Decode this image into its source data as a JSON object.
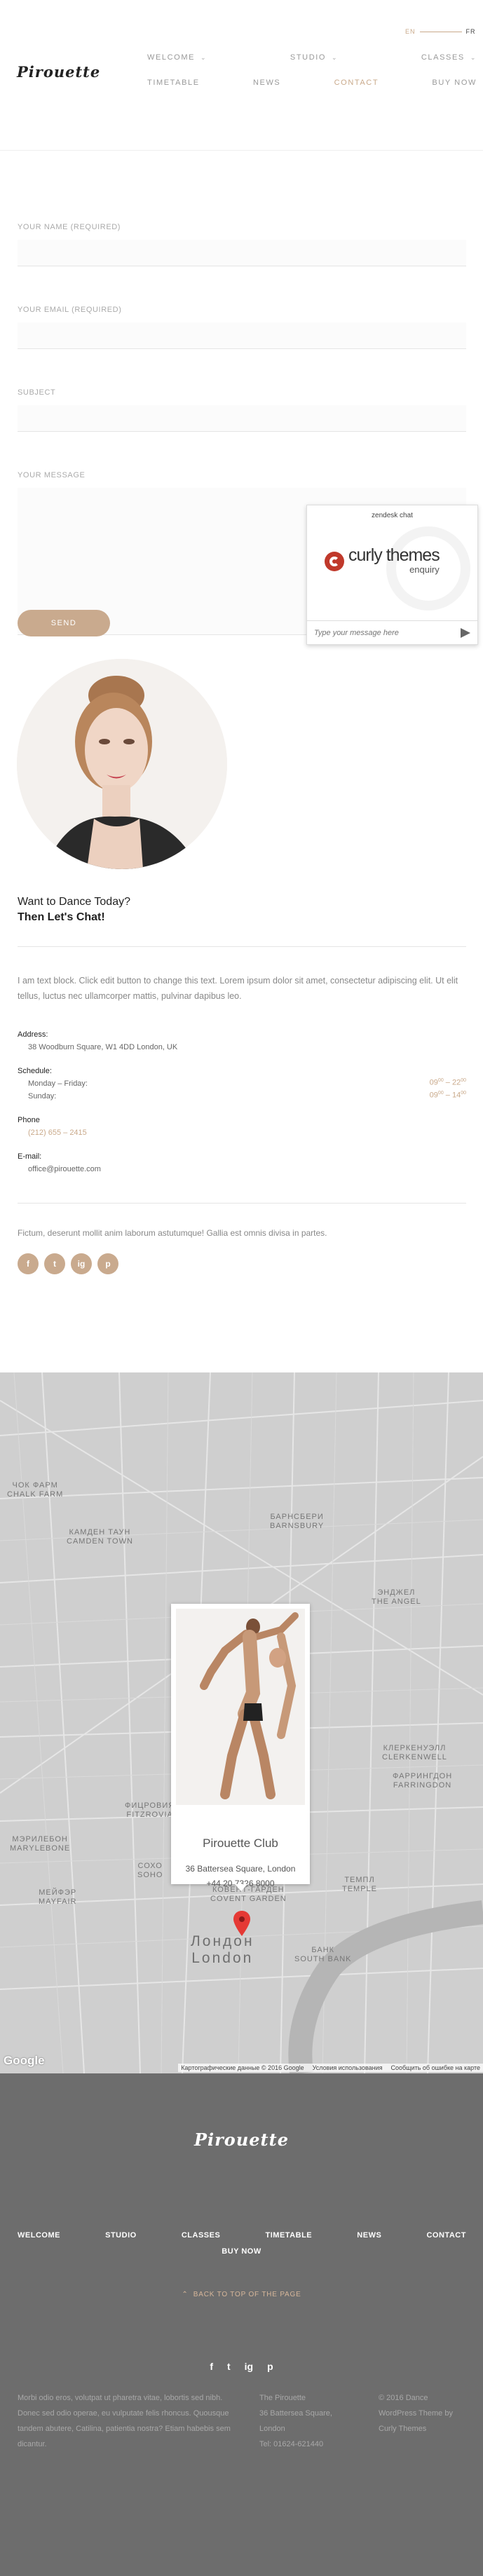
{
  "header": {
    "lang_active": "EN",
    "lang_other": "FR",
    "logo": "Pirouette",
    "nav_row1": [
      {
        "label": "WELCOME",
        "dropdown": true
      },
      {
        "label": "STUDIO",
        "dropdown": true
      },
      {
        "label": "CLASSES",
        "dropdown": true
      }
    ],
    "nav_row2": [
      {
        "label": "TIMETABLE",
        "active": false
      },
      {
        "label": "NEWS",
        "active": false
      },
      {
        "label": "CONTACT",
        "active": true
      },
      {
        "label": "BUY NOW",
        "active": false
      }
    ]
  },
  "form": {
    "name_label": "YOUR NAME (REQUIRED)",
    "email_label": "YOUR EMAIL (REQUIRED)",
    "subject_label": "SUBJECT",
    "message_label": "YOUR MESSAGE",
    "send_label": "SEND"
  },
  "chat": {
    "title": "zendesk chat",
    "brand": "curly themes",
    "sub": "enquiry",
    "placeholder": "Type your message here"
  },
  "contact": {
    "cta_line1": "Want to Dance Today?",
    "cta_line2": "Then Let's Chat!",
    "lorem": "I am text block. Click edit button to change this text. Lorem ipsum dolor sit amet, consectetur adipiscing elit. Ut elit tellus, luctus nec ullamcorper mattis, pulvinar dapibus leo.",
    "address_label": "Address:",
    "address": "38 Woodburn Square, W1 4DD London, UK",
    "schedule_label": "Schedule:",
    "weekdays": "Monday – Friday:",
    "weekdays_open": "09",
    "weekdays_open_min": "00",
    "weekdays_close": "22",
    "weekdays_close_min": "00",
    "sunday": "Sunday:",
    "sunday_open": "09",
    "sunday_open_min": "00",
    "sunday_close": "14",
    "sunday_close_min": "00",
    "phone_label": "Phone",
    "phone": "(212) 655 – 2415",
    "email_label": "E-mail:",
    "email": "office@pirouette.com",
    "tagline": "Fictum, deserunt mollit anim laborum astutumque! Gallia est omnis divisa in partes.",
    "socials": [
      "f",
      "t",
      "ig",
      "p"
    ]
  },
  "map": {
    "labels": [
      {
        "text": "ЧОК ФАРМ\nCHALK FARM"
      },
      {
        "text": "КАМДЕН ТАУН\nCAMDEN TOWN"
      },
      {
        "text": "БАРНСБЕРИ\nBARNSBURY"
      },
      {
        "text": "ЭНДЖЕЛ\nTHE ANGEL"
      },
      {
        "text": "КЛЕРКЕНУЭЛЛ\nCLERKENWELL"
      },
      {
        "text": "ФАРРИНГДОН\nFARRINGDON"
      },
      {
        "text": "ФИЦРОВИЯ\nFITZROVIA"
      },
      {
        "text": "МЭРИЛЕБОН\nMARYLEBONE"
      },
      {
        "text": "СОХО\nSOHO"
      },
      {
        "text": "КОВЕНТ-ГАРДЕН\nCOVENT GARDEN"
      },
      {
        "text": "МЕЙФЭР\nMAYFAIR"
      },
      {
        "text": "ТЕМПЛ\nTEMPLE"
      },
      {
        "text": "БАНК\nSOUTH BANK"
      }
    ],
    "city_ru": "Лондон",
    "city_en": "London",
    "club_name": "Pirouette Club",
    "club_address": "36 Battersea Square, London",
    "club_phone": "+44 20 7326 8000",
    "google": "Google",
    "terms": [
      "Картографические данные © 2016 Google",
      "Условия использования",
      "Сообщить об ошибке на карте"
    ]
  },
  "footer": {
    "logo": "Pirouette",
    "nav": [
      "WELCOME",
      "STUDIO",
      "CLASSES",
      "TIMETABLE",
      "NEWS",
      "CONTACT"
    ],
    "nav_extra": "BUY NOW",
    "back_to_top": "BACK TO TOP OF THE PAGE",
    "socials": [
      "f",
      "t",
      "ig",
      "p"
    ],
    "col1": "Morbi odio eros, volutpat ut pharetra vitae, lobortis sed nibh. Donec sed odio operae, eu vulputate felis rhoncus. Quousque tandem abutere, Catilina, patientia nostra? Etiam habebis sem dicantur.",
    "col2_line1": "The Pirouette",
    "col2_line2": "36 Battersea Square,",
    "col2_line3": "London",
    "col2_line4": "Tel: 01624-621440",
    "col3": "© 2016 Dance WordPress Theme by Curly Themes"
  },
  "colors": {
    "accent": "#c9aa8e",
    "footer_bg": "#6d6d6d",
    "map_bg": "#cfcfcf"
  }
}
